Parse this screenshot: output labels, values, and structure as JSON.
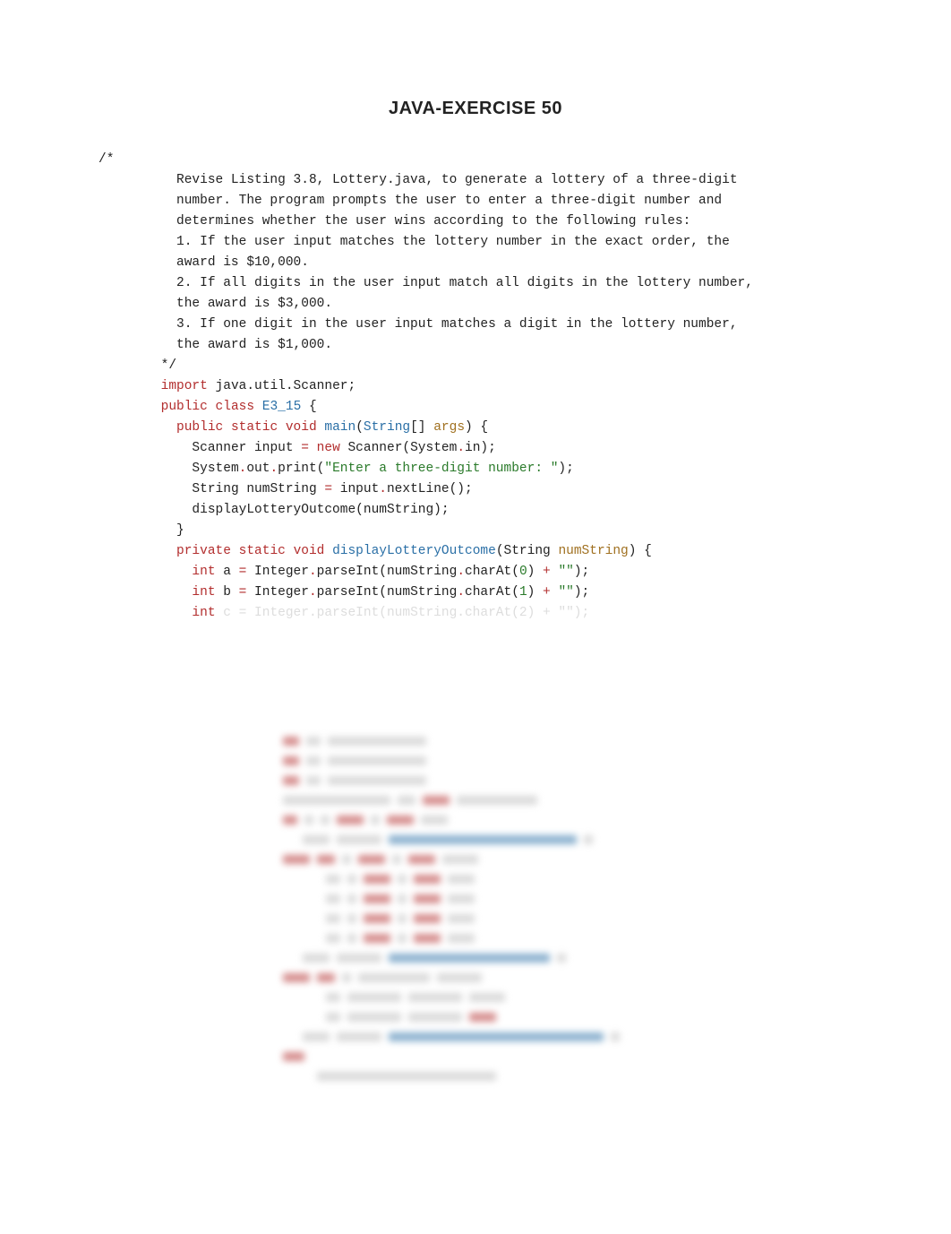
{
  "title": "JAVA-EXERCISE 50",
  "code": {
    "c1": "/*",
    "c2": "          Revise Listing 3.8, Lottery.java, to generate a lottery of a three-digit",
    "c3": "          number. The program prompts the user to enter a three-digit number and",
    "c4": "          determines whether the user wins according to the following rules:",
    "c5": "          1. If the user input matches the lottery number in the exact order, the",
    "c6": "          award is $10,000.",
    "c7": "          2. If all digits in the user input match all digits in the lottery number,",
    "c8": "          the award is $3,000.",
    "c9": "          3. If one digit in the user input matches a digit in the lottery number,",
    "c10": "          the award is $1,000.",
    "c11": "        */",
    "kw_import": "import",
    "import_rest": " java.util.Scanner;",
    "kw_public": "public",
    "kw_class": "class",
    "class_name": "E3_15",
    "brace_open": " {",
    "kw_public2": "public",
    "kw_static": "static",
    "kw_void": "void",
    "mtd_main": "main",
    "lp": "(",
    "type_string": "String",
    "arr": "[] ",
    "param_args": "args",
    "rp_brace": ") {",
    "line_scanner_a": "    Scanner input ",
    "eq": "=",
    "kw_new": " new",
    "line_scanner_b": " Scanner(System",
    "dot": ".",
    "in_rp": "in);",
    "sys": "    System",
    "out": "out",
    "print": "print(",
    "str_prompt": "\"Enter a three-digit number: \"",
    "rp_semi": ");",
    "line_ns_a": "    String numString ",
    "line_ns_b": " input",
    "nextLine": "nextLine();",
    "line_call": "    displayLotteryOutcome(numString);",
    "rbrace": "  }",
    "kw_private": "private",
    "mtd_dlo": "displayLotteryOutcome",
    "param_paren_a": "(String ",
    "param_numString": "numString",
    "rp_brace2": ") {",
    "kw_int": "int",
    "var_a": " a ",
    "var_b": " b ",
    "parse_a": " Integer",
    "parseInt": "parseInt(numString",
    "charAt": "charAt(",
    "n0": "0",
    "n1": "1",
    "rp": ") ",
    "plus": "+",
    "emptystr": " \"\"",
    "rp_semi2": ");"
  }
}
